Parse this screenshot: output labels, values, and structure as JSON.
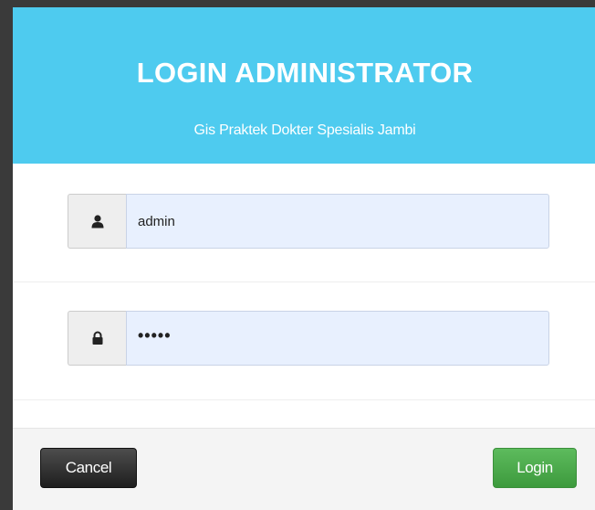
{
  "modal": {
    "title": "LOGIN ADMINISTRATOR",
    "subtitle": "Gis Praktek Dokter Spesialis Jambi"
  },
  "username": {
    "icon": "user-icon",
    "value": "admin"
  },
  "password": {
    "icon": "lock-icon",
    "value": "•••••"
  },
  "footer": {
    "cancel_label": "Cancel",
    "login_label": "Login"
  },
  "colors": {
    "header": "#4ecbef",
    "login_button": "#4cae4c",
    "cancel_button": "#333333",
    "input_fill": "#e8f0fe"
  }
}
